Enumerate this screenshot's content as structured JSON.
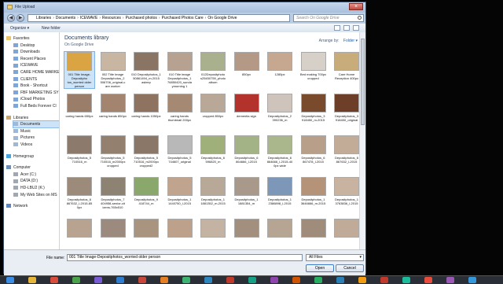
{
  "window": {
    "title": "File Upload"
  },
  "address": {
    "crumbs": [
      "Libraries",
      "Documents",
      "ICEWAVE",
      "Resources",
      "Purchased photos",
      "Purchased Photos Care",
      "On Google Drive"
    ]
  },
  "search": {
    "placeholder": "Search On Google Drive"
  },
  "toolbar": {
    "organize": "Organize ▾",
    "new_folder": "New folder"
  },
  "sidebar": {
    "favorites": "Favorites",
    "fav_items": [
      "Desktop",
      "Downloads",
      "Recent Places",
      "ICEWAVE",
      "CARE HOME MARKE",
      "CLIENTS",
      "Book - Shortcut",
      "FBF MARKETING SY",
      "iCloud Photos",
      "Full Beds Forever Cl"
    ],
    "libraries": "Libraries",
    "lib_items": [
      "Documents",
      "Music",
      "Pictures",
      "Videos"
    ],
    "homegroup": "Homegroup",
    "computer": "Computer",
    "comp_items": [
      "Acer (C:)",
      "DATA (D:)",
      "HD-LBU2 (K:)",
      "My Web Sites on MS"
    ],
    "network": "Network"
  },
  "main": {
    "library_title": "Documents library",
    "library_sub": "On Google Drive",
    "arrange_label": "Arrange by:",
    "arrange_value": "Folder ▾",
    "files": [
      {
        "label": "001 Title Image-Depositpho tos_worried older person",
        "color": "#d9a441"
      },
      {
        "label": "002 Title Image Depositphotos_2 506706_original-c are worker",
        "color": "#c9b6a2"
      },
      {
        "label": "010 Depositphotos_1 50861494_m-2015 asleep",
        "color": "#8a7464"
      },
      {
        "label": "010 Title image Depositphotos_1 76850420_sunda ymorning 1",
        "color": "#b7a190"
      },
      {
        "label": "012Depositphoto s25450759_photo album",
        "color": "#a9b08e"
      },
      {
        "label": "850px",
        "color": "#b49a86"
      },
      {
        "label": "1280px",
        "color": "#c6a891"
      },
      {
        "label": "Bed making 700px cropped",
        "color": "#d6d0c8"
      },
      {
        "label": "Care Home Reception 400px",
        "color": "#c8ad7a"
      },
      {
        "label": "caring hands 650px",
        "color": "#9b7e6a"
      },
      {
        "label": "caring hands 850px",
        "color": "#a3856f"
      },
      {
        "label": "caring hands 1050px",
        "color": "#8f7361"
      },
      {
        "label": "caring hands thumbnail 200px",
        "color": "#a68973"
      },
      {
        "label": "cropped 850px",
        "color": "#b9a898"
      },
      {
        "label": "dementia sign",
        "color": "#b3322b"
      },
      {
        "label": "Depositphotos_2 390236_m",
        "color": "#cfc4bb"
      },
      {
        "label": "Depositphotos_3 918450_m-2015",
        "color": "#7a4a2c"
      },
      {
        "label": "Depositphotos_3 918450_original",
        "color": "#6d3f28"
      },
      {
        "label": "Depositphotos_5 710516_m",
        "color": "#8c7a6d"
      },
      {
        "label": "Depositphotos_5 710516_m2000px cropped",
        "color": "#94806f"
      },
      {
        "label": "Depositphotos_5 710516_m2000px cropped2",
        "color": "#8b7767"
      },
      {
        "label": "Depositphotos_5 744607_original",
        "color": "#b8b8b8"
      },
      {
        "label": "Depositphotos_6 596820_m",
        "color": "#9fb07a"
      },
      {
        "label": "Depositphotos_6 864666_l-2015",
        "color": "#a4b385"
      },
      {
        "label": "Depositphotos_6 864666_l-2015-40 0px wide",
        "color": "#aab78c"
      },
      {
        "label": "Depositphotos_6 867478_l-2015",
        "color": "#b79f8a"
      },
      {
        "label": "Depositphotos_6 867632_l-2015",
        "color": "#c2ab97"
      },
      {
        "label": "Depositphotos_6 867632_l-2015-85 0px",
        "color": "#9c8a7b"
      },
      {
        "label": "Depositphotos_7 404958-senior-cit izens-765x510",
        "color": "#8e8273"
      },
      {
        "label": "Depositphotos_9 418744_m",
        "color": "#8aa86b"
      },
      {
        "label": "Depositphotos_1 1440750_l-2015",
        "color": "#c0a48d"
      },
      {
        "label": "Depositphotos_1 1881352_m-2015",
        "color": "#b8a898"
      },
      {
        "label": "Depositphotos_1 1881354_m",
        "color": "#a9998b"
      },
      {
        "label": "Depositphotos_1 2386898_l-2015",
        "color": "#7c97b8"
      },
      {
        "label": "Depositphotos_1 3646666_m-2015",
        "color": "#b59378"
      },
      {
        "label": "Depositphotos_1 3763836_l-2015",
        "color": "#c7b3a0"
      },
      {
        "label": "",
        "color": "#b8a390"
      },
      {
        "label": "",
        "color": "#9b8a7d"
      },
      {
        "label": "",
        "color": "#a8947f"
      },
      {
        "label": "",
        "color": "#bda18a"
      },
      {
        "label": "",
        "color": "#c4b2a2"
      },
      {
        "label": "",
        "color": "#a38f7d"
      },
      {
        "label": "",
        "color": "#b7a594"
      },
      {
        "label": "",
        "color": "#9f8c7b"
      },
      {
        "label": "",
        "color": "#c0ab98"
      }
    ]
  },
  "footer": {
    "filename_label": "File name:",
    "filename_value": "001 Title Image-Depositphotos_worried older person",
    "filter_value": "All Files",
    "open_label": "Open",
    "cancel_label": "Cancel"
  }
}
